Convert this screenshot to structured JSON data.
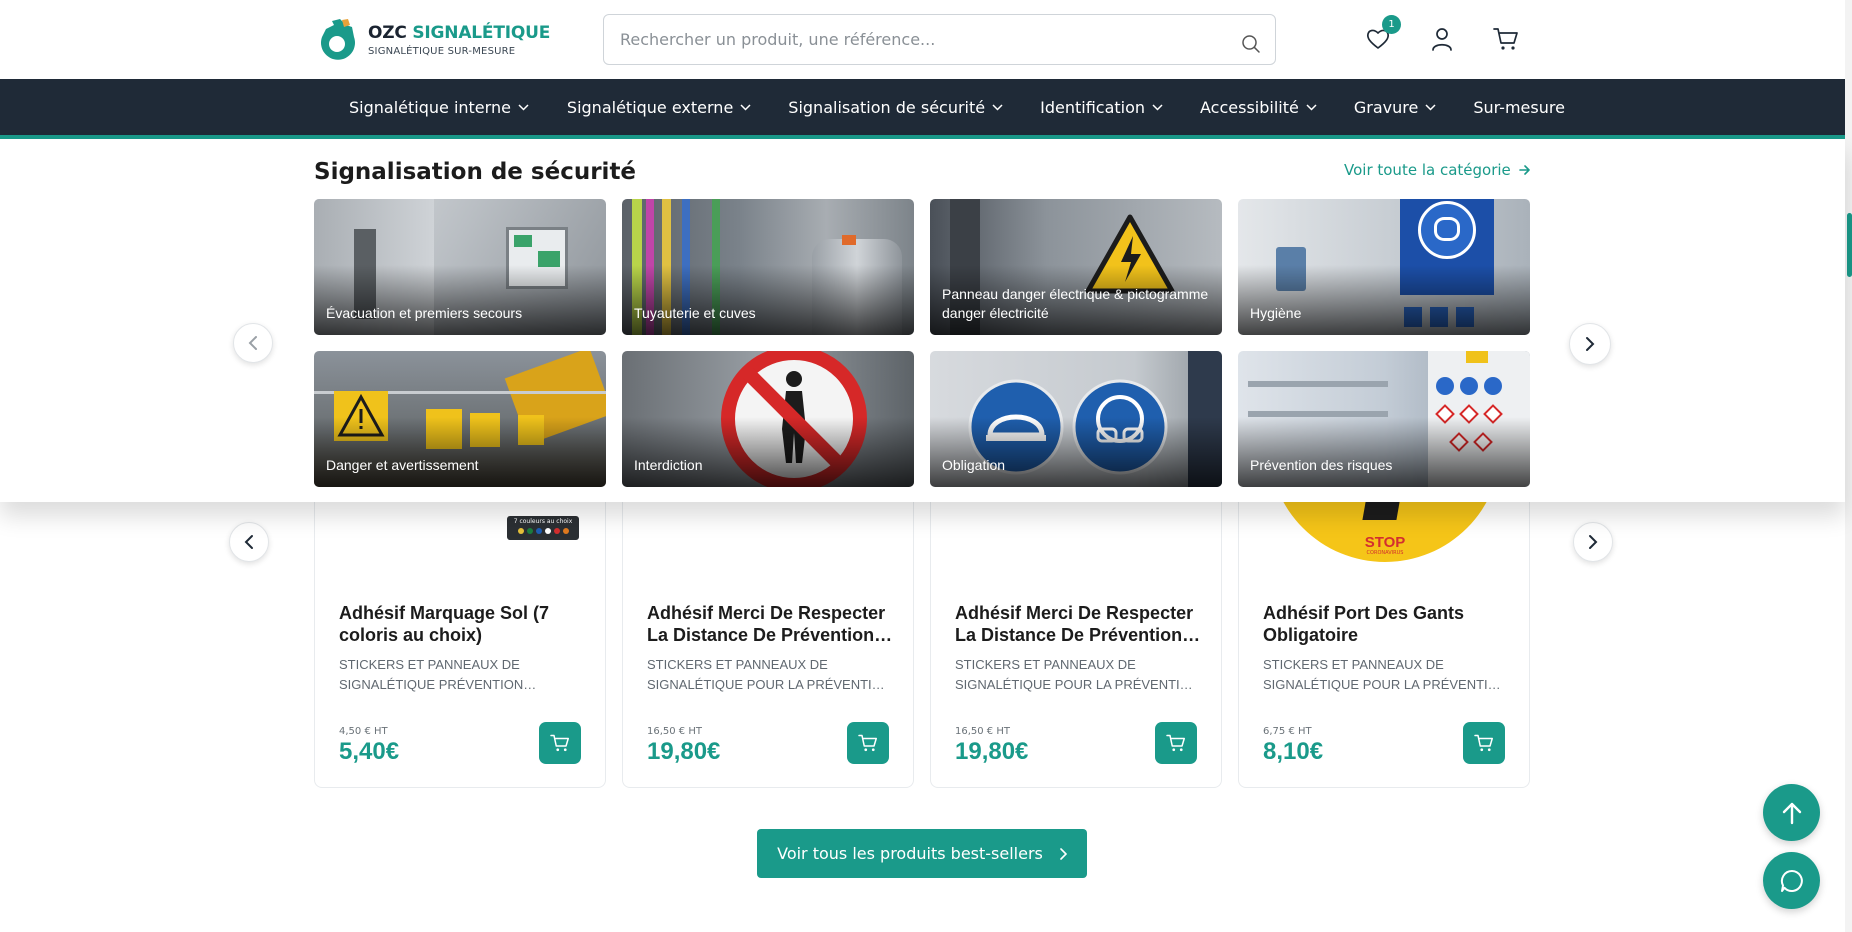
{
  "brand": {
    "name_part1": "OZC",
    "name_part2": "SIGNALÉTIQUE",
    "tagline": "SIGNALÉTIQUE SUR-MESURE",
    "accent_color": "#1a9a8a",
    "dark_color": "#1f2a37"
  },
  "search": {
    "placeholder": "Rechercher un produit, une référence...",
    "icon": "search-icon"
  },
  "header_icons": {
    "wishlist_icon": "heart-icon",
    "wishlist_count": "1",
    "account_icon": "user-icon",
    "cart_icon": "cart-icon"
  },
  "nav": {
    "items": [
      {
        "label": "Signalétique interne",
        "has_dropdown": true
      },
      {
        "label": "Signalétique externe",
        "has_dropdown": true
      },
      {
        "label": "Signalisation de sécurité",
        "has_dropdown": true
      },
      {
        "label": "Identification",
        "has_dropdown": true
      },
      {
        "label": "Accessibilité",
        "has_dropdown": true
      },
      {
        "label": "Gravure",
        "has_dropdown": true
      },
      {
        "label": "Sur-mesure",
        "has_dropdown": false
      }
    ]
  },
  "mega_menu": {
    "title": "Signalisation de sécurité",
    "view_all_label": "Voir toute la catégorie",
    "tiles": [
      {
        "label": "Évacuation et premiers secours"
      },
      {
        "label": "Tuyauterie et cuves"
      },
      {
        "label": "Panneau danger électrique & pictogramme danger électricité"
      },
      {
        "label": "Hygiène"
      },
      {
        "label": "Danger et avertissement"
      },
      {
        "label": "Interdiction"
      },
      {
        "label": "Obligation"
      },
      {
        "label": "Prévention des risques"
      }
    ]
  },
  "products": {
    "items": [
      {
        "name": "Adhésif Marquage Sol (7 coloris au choix)",
        "category": "STICKERS ET PANNEAUX DE SIGNALÉTIQUE PRÉVENTION…",
        "price_ht": "4,50 € HT",
        "price_ttc": "5,40€",
        "image_badge": "7 couleurs au choix"
      },
      {
        "name": "Adhésif Merci De Respecter La Distance De Prévention…",
        "category": "STICKERS ET PANNEAUX DE SIGNALÉTIQUE POUR LA PRÉVENTI…",
        "price_ht": "16,50 € HT",
        "price_ttc": "19,80€"
      },
      {
        "name": "Adhésif Merci De Respecter La Distance De Prévention…",
        "category": "STICKERS ET PANNEAUX DE SIGNALÉTIQUE POUR LA PRÉVENTI…",
        "price_ht": "16,50 € HT",
        "price_ttc": "19,80€"
      },
      {
        "name": "Adhésif Port Des Gants Obligatoire",
        "category": "STICKERS ET PANNEAUX DE SIGNALÉTIQUE POUR LA PRÉVENTI…",
        "price_ht": "6,75 € HT",
        "price_ttc": "8,10€",
        "image_text": "STOP",
        "image_subtext": "CORONAVIRUS"
      }
    ]
  },
  "cta": {
    "label": "Voir tous les produits best-sellers"
  },
  "floating": {
    "scroll_top_icon": "arrow-up-icon",
    "chat_icon": "chat-icon"
  }
}
